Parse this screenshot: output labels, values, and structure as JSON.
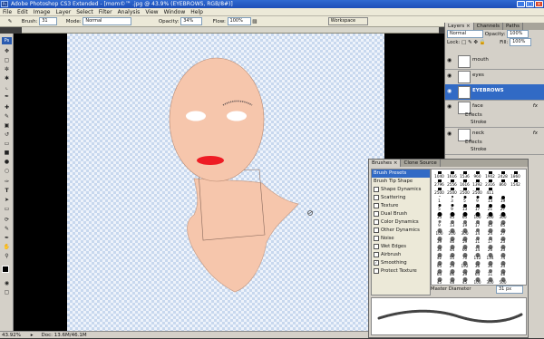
{
  "window": {
    "title": "Adobe Photoshop CS3 Extended - [mom©™  .jpg @ 43.9% (EYEBROWS, RGB/8#)]",
    "controls": [
      "_",
      "□",
      "×"
    ]
  },
  "menu": [
    "File",
    "Edit",
    "Image",
    "Layer",
    "Select",
    "Filter",
    "Analysis",
    "View",
    "Window",
    "Help"
  ],
  "options": {
    "brush_label": "Brush:",
    "brush_size": "31",
    "mode_label": "Mode:",
    "mode_value": "Normal",
    "opacity_label": "Opacity:",
    "opacity_value": "34%",
    "flow_label": "Flow:",
    "flow_value": "100%",
    "workspace_label": "Workspace"
  },
  "status": {
    "zoom": "43.92%",
    "doc": "Doc: 13.6M/46.1M"
  },
  "layers_panel": {
    "tabs": [
      "Layers ×",
      "Channels",
      "Paths"
    ],
    "blend_mode": "Normal",
    "opacity_label": "Opacity:",
    "opacity_value": "100%",
    "lock_label": "Lock:",
    "fill_label": "Fill:",
    "fill_value": "100%",
    "layers": [
      {
        "name": "mouth",
        "selected": false
      },
      {
        "name": "eyes",
        "selected": false
      },
      {
        "name": "EYEBROWS",
        "selected": true
      },
      {
        "name": "face",
        "fx": "fx",
        "effects": [
          "Effects",
          "Stroke"
        ]
      },
      {
        "name": "neck",
        "fx": "fx",
        "effects": [
          "Effects",
          "Stroke"
        ]
      }
    ]
  },
  "brushes_panel": {
    "tabs": [
      "Brushes ×",
      "Clone Source"
    ],
    "presets": [
      "Brush Presets",
      "Brush Tip Shape",
      "Shape Dynamics",
      "Scattering",
      "Texture",
      "Dual Brush",
      "Color Dynamics",
      "Other Dynamics",
      "Noise",
      "Wet Edges",
      "Airbrush",
      "Smoothing",
      "Protect Texture"
    ],
    "checked": [
      false,
      false,
      false,
      false,
      false,
      false,
      false,
      false,
      false,
      false,
      false,
      true,
      false
    ],
    "grid_sizes": [
      [
        "1040",
        "1616",
        "1536",
        "960",
        "1902",
        "2428",
        "1860"
      ],
      [
        "2796",
        "2556",
        "1616",
        "1392",
        "2316",
        "860",
        "1542"
      ],
      [
        "2500",
        "2500",
        "2500",
        "2500",
        "411",
        "",
        ""
      ],
      [
        "1",
        "3",
        "5",
        "9",
        "13",
        "19",
        ""
      ],
      [
        "5",
        "9",
        "13",
        "17",
        "21",
        "27",
        ""
      ],
      [
        "35",
        "45",
        "65",
        "100",
        "200",
        "300",
        ""
      ],
      [
        "9",
        "13",
        "19",
        "17",
        "45",
        "65",
        ""
      ],
      [
        "100",
        "200",
        "300",
        "14",
        "24",
        "27",
        ""
      ],
      [
        "39",
        "46",
        "59",
        "11",
        "17",
        "23",
        ""
      ],
      [
        "36",
        "44",
        "60",
        "14",
        "26",
        "33",
        ""
      ],
      [
        "42",
        "55",
        "70",
        "112",
        "134",
        "74",
        ""
      ],
      [
        "95",
        "29",
        "192",
        "36",
        "36",
        "33",
        ""
      ],
      [
        "63",
        "66",
        "39",
        "63",
        "11",
        "48",
        ""
      ],
      [
        "45",
        "48",
        "45",
        "100",
        "300",
        "500",
        ""
      ]
    ],
    "master_diameter_label": "Master Diameter",
    "master_diameter_value": "31 px"
  },
  "colors": {
    "skin": "#f6c6ac",
    "skin_stroke": "#b88a72",
    "lips": "#ee1c24",
    "eyes": "#ffffff",
    "selected_layer": "#316ac5"
  }
}
